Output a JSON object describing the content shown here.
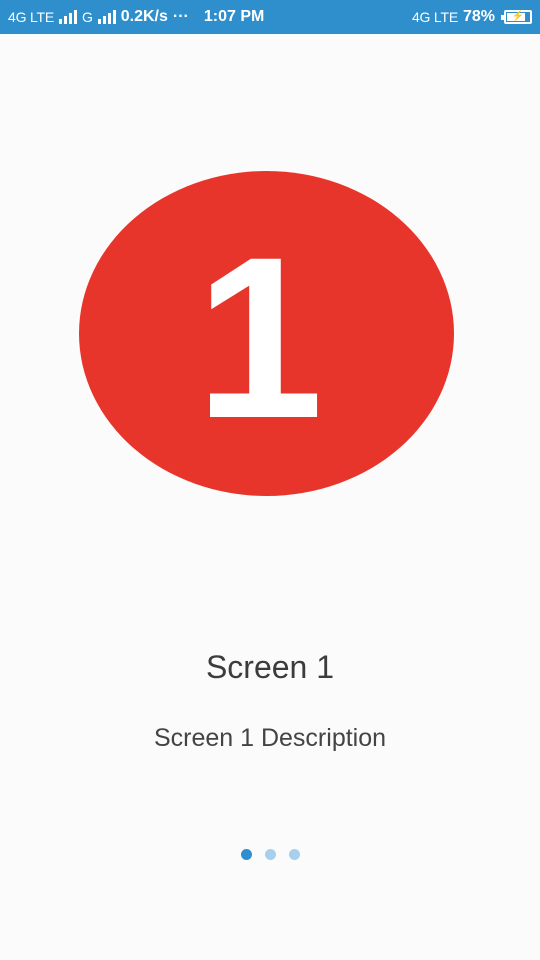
{
  "status_bar": {
    "network_left": "4G LTE",
    "network_second": "G",
    "speed": "0.2K/s",
    "dots": "···",
    "time": "1:07 PM",
    "network_right": "4G LTE",
    "battery_percent": "78%"
  },
  "screen": {
    "hero_number": "1",
    "title": "Screen 1",
    "description": "Screen 1 Description"
  },
  "pager": {
    "count": 3,
    "active_index": 0
  },
  "colors": {
    "status_bar": "#2f8fcd",
    "hero": "#e8352b",
    "dot_active": "#2d8ed0",
    "dot_inactive": "#a7d0ee"
  }
}
